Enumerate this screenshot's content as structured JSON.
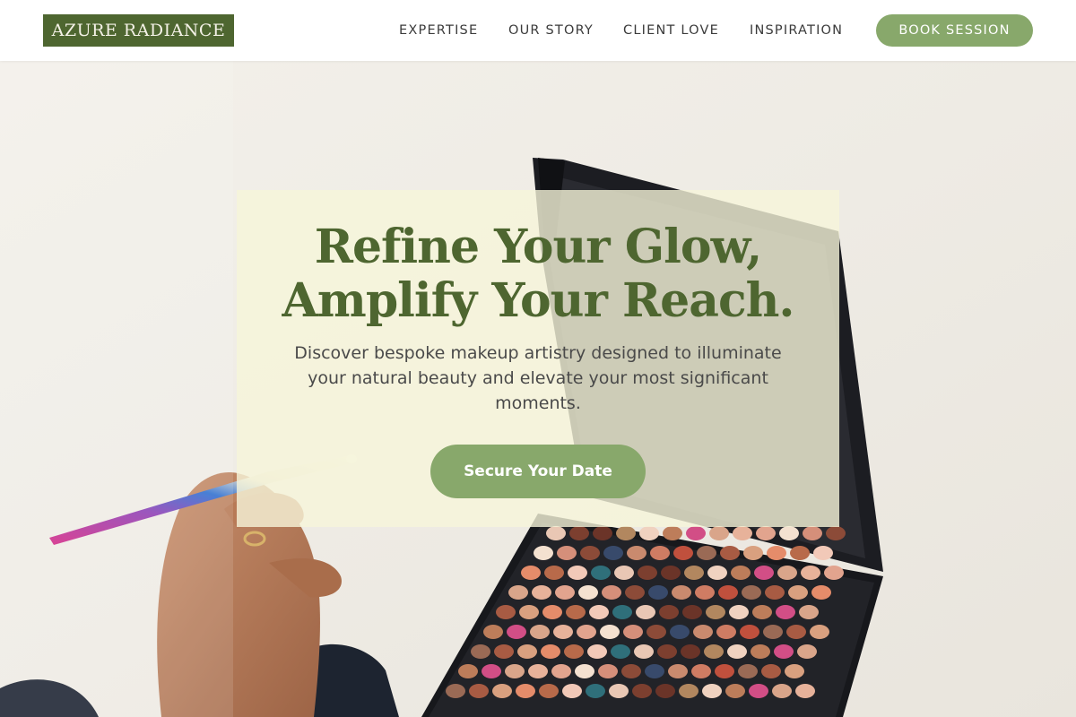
{
  "header": {
    "logo": "AZURE RADIANCE",
    "nav": {
      "expertise": "EXPERTISE",
      "story": "OUR STORY",
      "client_love": "CLIENT LOVE",
      "inspiration": "INSPIRATION"
    },
    "book_button": "BOOK SESSION"
  },
  "hero": {
    "title_line1": "Refine Your Glow,",
    "title_line2": "Amplify Your Reach.",
    "subtitle": "Discover bespoke makeup artistry designed to illuminate your natural beauty and elevate your most significant moments.",
    "cta": "Secure Your Date"
  },
  "colors": {
    "brand_green": "#4e6630",
    "accent_green": "#88a86b",
    "card_cream": "#f6f5da"
  },
  "hero_image": {
    "subject": "hand-holding-makeup-brush-over-eyeshadow-palette"
  }
}
